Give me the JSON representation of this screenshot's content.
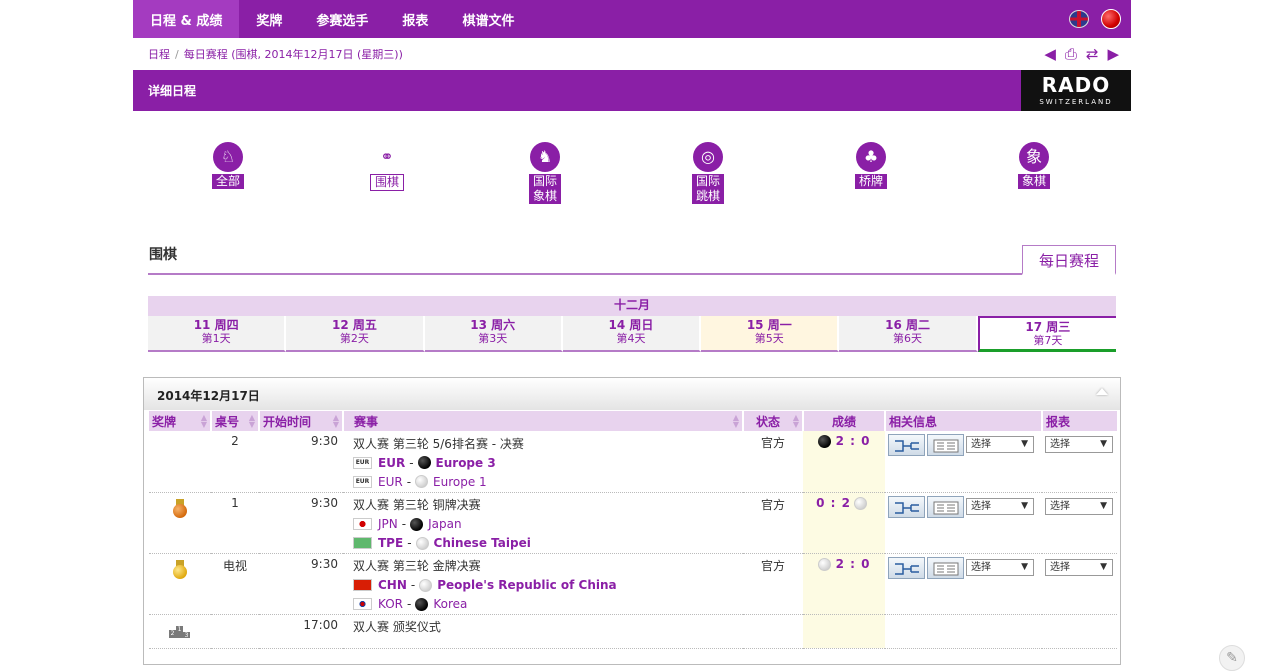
{
  "nav": {
    "items": [
      {
        "label": "日程 & 成绩",
        "active": true
      },
      {
        "label": "奖牌"
      },
      {
        "label": "参赛选手"
      },
      {
        "label": "报表"
      },
      {
        "label": "棋谱文件"
      }
    ]
  },
  "breadcrumb": {
    "root": "日程",
    "sep": "/",
    "current": "每日赛程 (围棋, 2014年12月17日 (星期三))"
  },
  "titlebar": {
    "title": "详细日程",
    "sponsor_big": "RADO",
    "sponsor_small": "SWITZERLAND"
  },
  "sports": [
    {
      "label": "全部",
      "icon": "all-sports-icon",
      "glyph": "🏃"
    },
    {
      "label": "围棋",
      "icon": "go-icon",
      "glyph": "⚲"
    },
    {
      "label1": "国际",
      "label2": "象棋",
      "icon": "chess-icon",
      "glyph": "♞"
    },
    {
      "label1": "国际",
      "label2": "跳棋",
      "icon": "draughts-icon",
      "glyph": "◎"
    },
    {
      "label": "桥牌",
      "icon": "bridge-icon",
      "glyph": "♣"
    },
    {
      "label": "象棋",
      "icon": "xiangqi-icon",
      "glyph": "象"
    }
  ],
  "section": {
    "title": "围棋",
    "tab": "每日赛程"
  },
  "calendar": {
    "month": "十二月",
    "days": [
      {
        "date": "11 周四",
        "day": "第1天"
      },
      {
        "date": "12 周五",
        "day": "第2天"
      },
      {
        "date": "13 周六",
        "day": "第3天"
      },
      {
        "date": "14 周日",
        "day": "第4天"
      },
      {
        "date": "15 周一",
        "day": "第5天"
      },
      {
        "date": "16 周二",
        "day": "第6天"
      },
      {
        "date": "17 周三",
        "day": "第7天"
      }
    ]
  },
  "schedule": {
    "date": "2014年12月17日",
    "columns": {
      "medal": "奖牌",
      "table": "桌号",
      "start": "开始时间",
      "event": "赛事",
      "status": "状态",
      "result": "成绩",
      "info": "相关信息",
      "report": "报表"
    },
    "select_label": "选择",
    "rows": [
      {
        "table": "2",
        "time": "9:30",
        "event": "双人赛 第三轮 5/6排名赛 - 决赛",
        "team1_code": "EUR",
        "team1_name": "Europe 3",
        "team2_code": "EUR",
        "team2_name": "Europe 1",
        "status": "官方",
        "score": "2 : 0"
      },
      {
        "table": "1",
        "time": "9:30",
        "event": "双人赛 第三轮 铜牌决赛",
        "team1_code": "JPN",
        "team1_name": "Japan",
        "team2_code": "TPE",
        "team2_name": "Chinese Taipei",
        "status": "官方",
        "score": "0 : 2"
      },
      {
        "table": "电视",
        "time": "9:30",
        "event": "双人赛 第三轮 金牌决赛",
        "team1_code": "CHN",
        "team1_name": "People's Republic of China",
        "team2_code": "KOR",
        "team2_name": "Korea",
        "status": "官方",
        "score": "2 : 0"
      },
      {
        "time": "17:00",
        "event": "双人赛 颁奖仪式"
      }
    ]
  },
  "colors": {
    "brand": "#8a1fa6",
    "light": "#e8d3ee",
    "today_green": "#1a9e2a"
  }
}
